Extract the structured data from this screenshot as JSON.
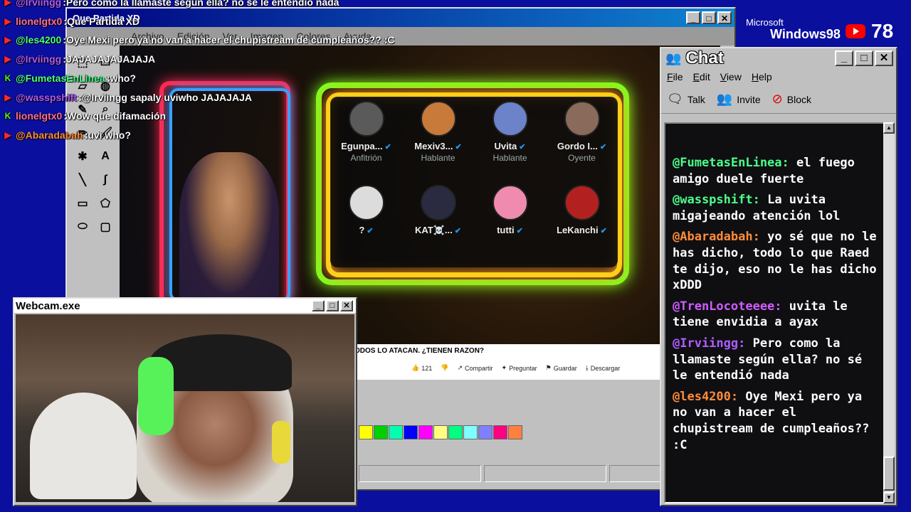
{
  "overlay_chat": [
    {
      "platform": "youtube",
      "name": "@Irviingg",
      "name_color": "#b05cff",
      "message": "Pero como la llamaste según ella? no se le entendió nada"
    },
    {
      "platform": "youtube",
      "name": "lionelgtx0",
      "name_color": "#ff6f9e",
      "message": "Que Partida XD"
    },
    {
      "platform": "youtube",
      "name": "@les4200",
      "name_color": "#4cff8a",
      "message": "Oye Mexi pero ya no van a hacer el chupistream de cumpleaños?? :C"
    },
    {
      "platform": "youtube",
      "name": "@Irviingg",
      "name_color": "#b05cff",
      "message": "JAJAJAJAJAJAJA"
    },
    {
      "platform": "kick",
      "name": "@FumetasEnLinea",
      "name_color": "#4cff8a",
      "message": "who?"
    },
    {
      "platform": "youtube",
      "name": "@wasspshift",
      "name_color": "#b05cff",
      "message": "@Irviingg sapaly uviwho JAJAJAJA"
    },
    {
      "platform": "kick",
      "name": "lionelgtx0",
      "name_color": "#ff6f9e",
      "message": "Wow que difamación"
    },
    {
      "platform": "youtube",
      "name": "@Abaradabah",
      "name_color": "#ff8c3a",
      "message": "uvi who?"
    }
  ],
  "paint": {
    "title": "Que Partida XD",
    "menu": [
      "Archivo",
      "Edición",
      "Ver",
      "Imagen",
      "Colores",
      "Ayuda"
    ],
    "tools": [
      "select-icon",
      "select-rect-icon",
      "eraser-icon",
      "fill-icon",
      "picker-icon",
      "magnifier-icon",
      "pencil-icon",
      "brush-icon",
      "airbrush-icon",
      "text-icon",
      "line-icon",
      "curve-icon",
      "rectangle-icon",
      "polygon-icon",
      "ellipse-icon",
      "rounded-rect-icon"
    ],
    "tool_glyphs": [
      "⬚",
      "▭",
      "▱",
      "◍",
      "✎",
      "⌕",
      "✏",
      "🖌",
      "✱",
      "A",
      "╲",
      "∫",
      "▭",
      "⬠",
      "⬭",
      "▢"
    ],
    "palette": [
      "#ffff00",
      "#00d000",
      "#00ffb0",
      "#0000ff",
      "#ff00ff",
      "#ffff80",
      "#00ff80",
      "#80ffff",
      "#8080ff",
      "#ff0080",
      "#ff8040"
    ]
  },
  "spaces": {
    "users": [
      {
        "name": "Egunpa...",
        "role": "Anfitrión"
      },
      {
        "name": "Mexiv3...",
        "role": "Hablante"
      },
      {
        "name": "Uvita",
        "role": "Hablante"
      },
      {
        "name": "Gordo I...",
        "role": "Oyente"
      },
      {
        "name": "?",
        "role": ""
      },
      {
        "name": "KAT☠️...",
        "role": ""
      },
      {
        "name": "tutti",
        "role": ""
      },
      {
        "name": "LeKanchi",
        "role": ""
      }
    ],
    "avatar_colors": [
      "#5a5a5a",
      "#c77a3a",
      "#6c82c9",
      "#8a6a5a",
      "#dcdcdc",
      "#2a2a40",
      "#f08bb0",
      "#b32020"
    ]
  },
  "youtube_bar": {
    "title": "ODOS LO ATACAN. ¿TIENEN RAZON?",
    "likes": "121",
    "actions": [
      "Compartir",
      "Preguntar",
      "Guardar",
      "Descargar"
    ]
  },
  "webcam": {
    "title": "Webcam.exe"
  },
  "chat": {
    "title": "Chat",
    "menu": [
      "File",
      "Edit",
      "View",
      "Help"
    ],
    "toolbar": [
      {
        "label": "Talk",
        "icon": "talk-icon",
        "glyph": "🗨"
      },
      {
        "label": "Invite",
        "icon": "invite-icon",
        "glyph": "👥"
      },
      {
        "label": "Block",
        "icon": "block-icon",
        "glyph": "⊘"
      }
    ],
    "messages": [
      {
        "name": "@FumetasEnLinea:",
        "name_color": "#4cff8a",
        "text": "el fuego amigo duele fuerte"
      },
      {
        "name": "@wasspshift:",
        "name_color": "#4cff8a",
        "text": "La uvita migajeando atención lol"
      },
      {
        "name": "@Abaradabah:",
        "name_color": "#ff8c3a",
        "text": "yo sé que no le has dicho, todo lo que Raed te dijo, eso no le has dicho xDDD"
      },
      {
        "name": "@TrenLocoteeee:",
        "name_color": "#d15cff",
        "text": "uvita le tiene envidia a ayax"
      },
      {
        "name": "@Irviingg:",
        "name_color": "#b05cff",
        "text": "Pero como la llamaste según ella? no sé le entendió nada"
      },
      {
        "name": "@les4200:",
        "name_color": "#ff8c3a",
        "text": "Oye Mexi pero ya no van a hacer el chupistream de cumpleaños?? :C"
      }
    ]
  },
  "brand": {
    "line1": "Microsoft",
    "line2": "Windows98"
  },
  "viewers": {
    "count": "78"
  }
}
